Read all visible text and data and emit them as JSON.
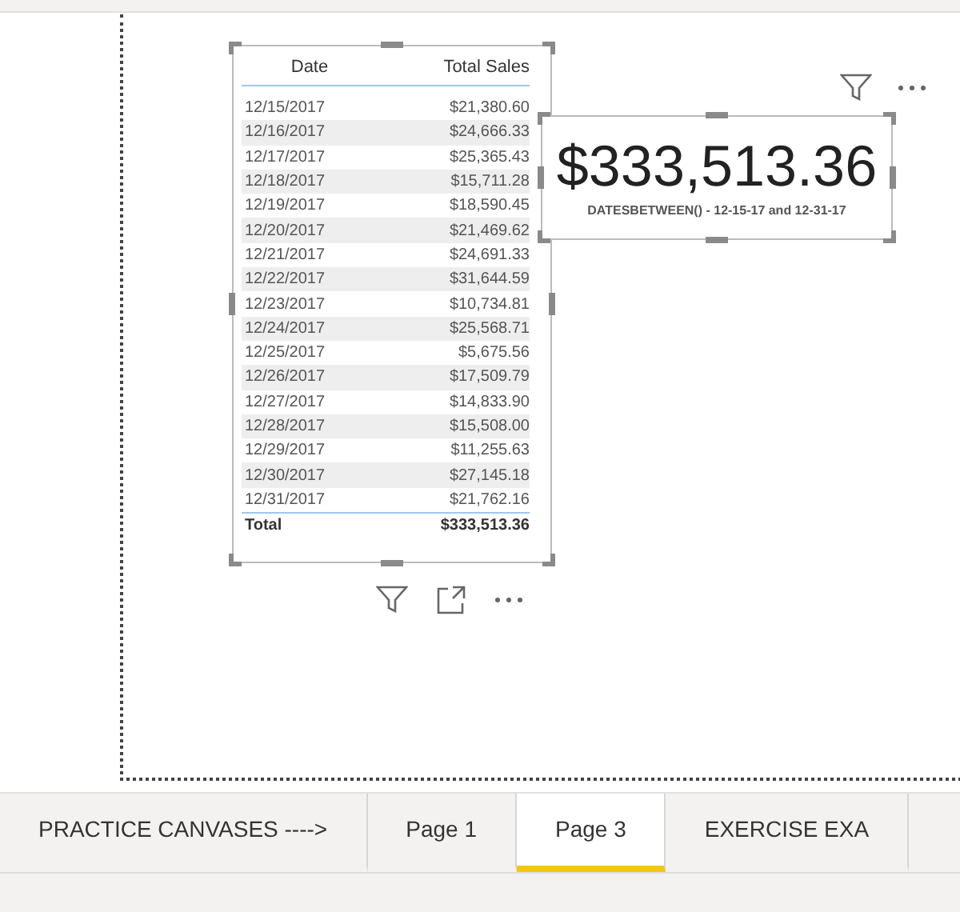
{
  "table": {
    "columns": [
      "Date",
      "Total Sales"
    ],
    "rows": [
      [
        "12/15/2017",
        "$21,380.60"
      ],
      [
        "12/16/2017",
        "$24,666.33"
      ],
      [
        "12/17/2017",
        "$25,365.43"
      ],
      [
        "12/18/2017",
        "$15,711.28"
      ],
      [
        "12/19/2017",
        "$18,590.45"
      ],
      [
        "12/20/2017",
        "$21,469.62"
      ],
      [
        "12/21/2017",
        "$24,691.33"
      ],
      [
        "12/22/2017",
        "$31,644.59"
      ],
      [
        "12/23/2017",
        "$10,734.81"
      ],
      [
        "12/24/2017",
        "$25,568.71"
      ],
      [
        "12/25/2017",
        "$5,675.56"
      ],
      [
        "12/26/2017",
        "$17,509.79"
      ],
      [
        "12/27/2017",
        "$14,833.90"
      ],
      [
        "12/28/2017",
        "$15,508.00"
      ],
      [
        "12/29/2017",
        "$11,255.63"
      ],
      [
        "12/30/2017",
        "$27,145.18"
      ],
      [
        "12/31/2017",
        "$21,762.16"
      ]
    ],
    "total": [
      "Total",
      "$333,513.36"
    ]
  },
  "card": {
    "value": "$333,513.36",
    "label": "DATESBETWEEN() - 12-15-17 and 12-31-17"
  },
  "tabs": [
    {
      "label": "PRACTICE CANVASES ---->",
      "selected": false
    },
    {
      "label": "Page 1",
      "selected": false
    },
    {
      "label": "Page 3",
      "selected": true
    },
    {
      "label": "EXERCISE EXA",
      "selected": false
    }
  ]
}
